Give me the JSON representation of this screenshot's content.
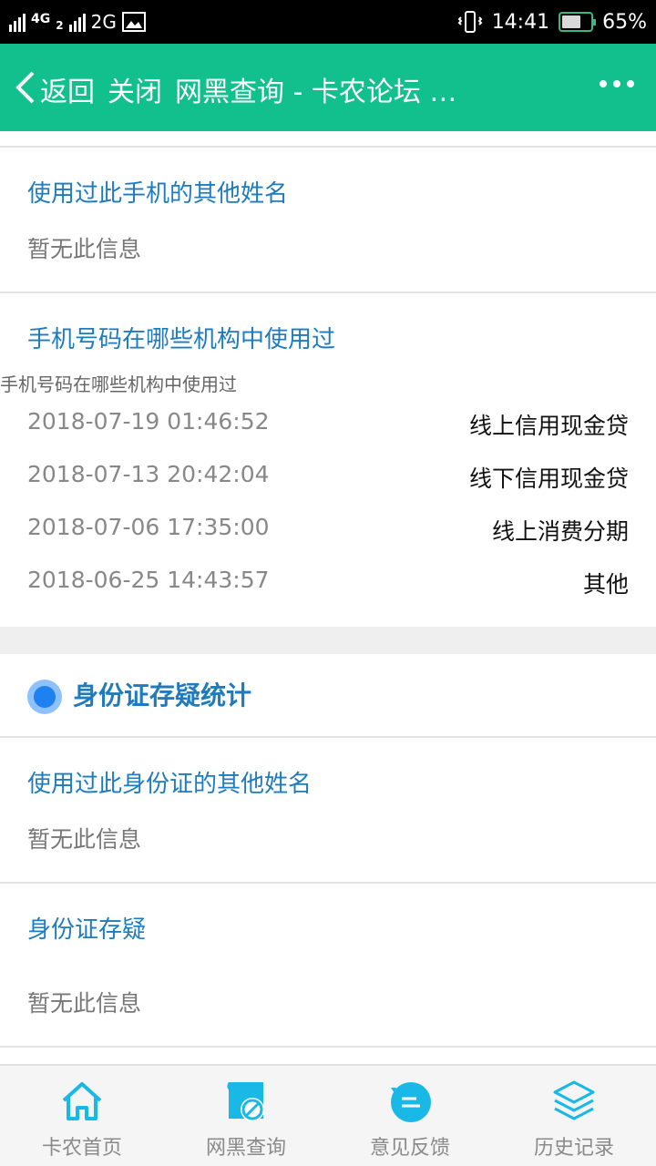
{
  "status_bar": {
    "network_1": "4G",
    "network_2": "2G",
    "sim_index": "2",
    "time": "14:41",
    "battery": "65%",
    "battery_level": 0.65
  },
  "header": {
    "back_label": "返回",
    "close_label": "关闭",
    "title": "网黑查询 - 卡农论坛 …"
  },
  "phone_names": {
    "title": "使用过此手机的其他姓名",
    "value": "暂无此信息"
  },
  "phone_institutions": {
    "title": "手机号码在哪些机构中使用过",
    "caption": "手机号码在哪些机构中使用过",
    "rows": [
      {
        "date": "2018-07-19 01:46:52",
        "type": "线上信用现金贷"
      },
      {
        "date": "2018-07-13 20:42:04",
        "type": "线下信用现金贷"
      },
      {
        "date": "2018-07-06 17:35:00",
        "type": "线上消费分期"
      },
      {
        "date": "2018-06-25 14:43:57",
        "type": "其他"
      }
    ]
  },
  "id_section": {
    "title": "身份证存疑统计",
    "names_title": "使用过此身份证的其他姓名",
    "names_value": "暂无此信息",
    "doubt_title": "身份证存疑",
    "doubt_value": "暂无此信息"
  },
  "tabbar": {
    "tabs": [
      {
        "label": "卡农首页",
        "icon": "home-icon"
      },
      {
        "label": "网黑查询",
        "icon": "blacklist-query-icon"
      },
      {
        "label": "意见反馈",
        "icon": "feedback-icon"
      },
      {
        "label": "历史记录",
        "icon": "history-layers-icon"
      }
    ]
  },
  "colors": {
    "header": "#12c08e",
    "accent_blue": "#1e7bbd",
    "tab_icon": "#1ab8e6"
  }
}
